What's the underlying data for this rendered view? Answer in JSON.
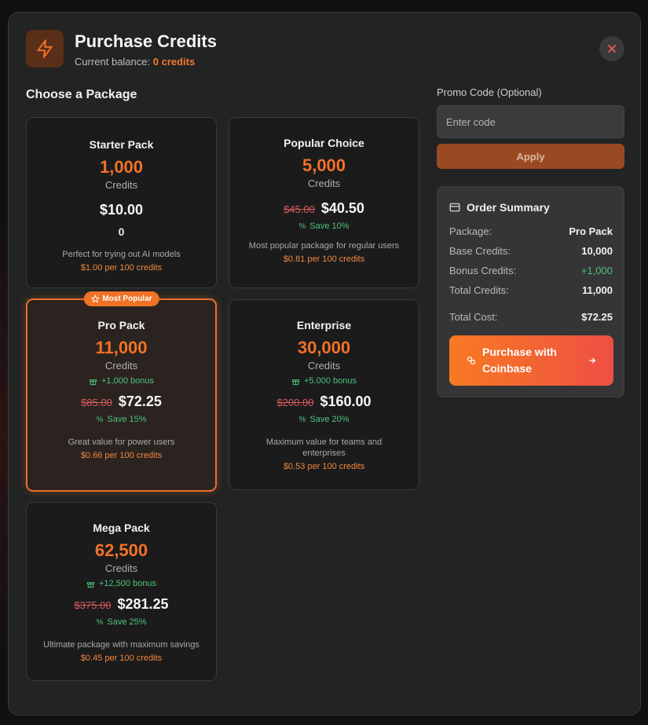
{
  "header": {
    "title": "Purchase Credits",
    "balance_prefix": "Current balance:",
    "balance_value": "0 credits"
  },
  "packages_section": {
    "title": "Choose a Package",
    "packages": [
      {
        "name": "Starter Pack",
        "amount": "1,000",
        "unit": "Credits",
        "bonus": "0",
        "old_price": "",
        "price": "$10.00",
        "save": "",
        "description": "Perfect for trying out AI models",
        "rate": "$1.00 per 100 credits",
        "selected": false
      },
      {
        "name": "Popular Choice",
        "amount": "5,000",
        "unit": "Credits",
        "bonus": "",
        "old_price": "$45.00",
        "price": "$40.50",
        "save": "Save 10%",
        "description": "Most popular package for regular users",
        "rate": "$0.81 per 100 credits",
        "selected": false
      },
      {
        "name": "Pro Pack",
        "amount": "11,000",
        "unit": "Credits",
        "bonus": "+1,000 bonus",
        "old_price": "$85.00",
        "price": "$72.25",
        "save": "Save 15%",
        "description": "Great value for power users",
        "rate": "$0.66 per 100 credits",
        "selected": true,
        "badge": "Most Popular"
      },
      {
        "name": "Enterprise",
        "amount": "30,000",
        "unit": "Credits",
        "bonus": "+5,000 bonus",
        "old_price": "$200.00",
        "price": "$160.00",
        "save": "Save 20%",
        "description": "Maximum value for teams and enterprises",
        "rate": "$0.53 per 100 credits",
        "selected": false
      },
      {
        "name": "Mega Pack",
        "amount": "62,500",
        "unit": "Credits",
        "bonus": "+12,500 bonus",
        "old_price": "$375.00",
        "price": "$281.25",
        "save": "Save 25%",
        "description": "Ultimate package with maximum savings",
        "rate": "$0.45 per 100 credits",
        "selected": false
      }
    ]
  },
  "promo": {
    "label": "Promo Code (Optional)",
    "placeholder": "Enter code",
    "value": "",
    "apply_label": "Apply"
  },
  "summary": {
    "title": "Order Summary",
    "rows": [
      {
        "label": "Package:",
        "value": "Pro Pack"
      },
      {
        "label": "Base Credits:",
        "value": "10,000"
      },
      {
        "label": "Bonus Credits:",
        "value": "+1,000"
      },
      {
        "label": "Total Credits:",
        "value": "11,000"
      },
      {
        "label": "Total Cost:",
        "value": "$72.25"
      }
    ],
    "purchase_label": "Purchase with Coinbase"
  },
  "colors": {
    "accent": "#f27226",
    "success": "#4ec27a",
    "strike": "#d45b5b",
    "modal_bg": "#222323"
  },
  "icons": {
    "header": "lightning-bolt-icon",
    "close": "close-x-icon",
    "badge": "star-icon",
    "bonus": "gift-icon",
    "save": "percent-icon",
    "summary": "credit-card-icon",
    "purchase": "coinbase-link-icon",
    "arrow": "arrow-right-icon"
  }
}
